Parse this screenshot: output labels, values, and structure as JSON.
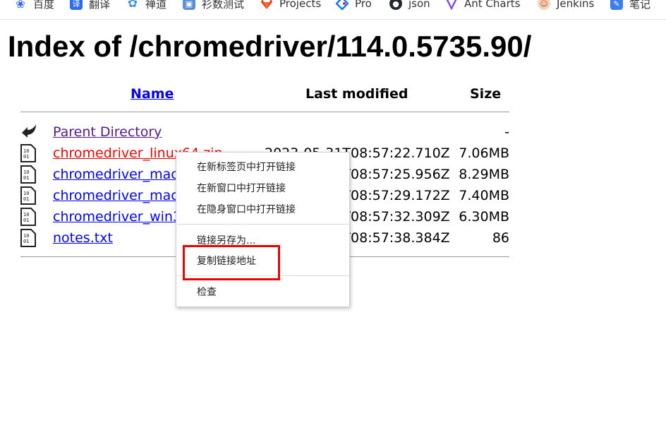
{
  "bookmarks": [
    {
      "label": "百度",
      "icon": "baidu-paw-icon",
      "color": "#3062f0"
    },
    {
      "label": "翻译",
      "icon": "translate-icon",
      "color": "#2a6bf2"
    },
    {
      "label": "禅道",
      "icon": "zentao-icon",
      "color": "#3d8fe8"
    },
    {
      "label": "衫数测试",
      "icon": "cube-icon",
      "color": "#5b8fd8"
    },
    {
      "label": "Projects",
      "icon": "gitlab-icon",
      "color": "#e24329"
    },
    {
      "label": "Pro",
      "icon": "diamond-icon",
      "color": "#1677ff"
    },
    {
      "label": "json",
      "icon": "github-icon",
      "color": "#24292e"
    },
    {
      "label": "Ant Charts",
      "icon": "ant-v-icon",
      "color": "#8a4bd8"
    },
    {
      "label": "Jenkins",
      "icon": "jenkins-icon",
      "color": "#d24939"
    },
    {
      "label": "笔记",
      "icon": "note-icon",
      "color": "#3b7cf0"
    }
  ],
  "page": {
    "title": "Index of /chromedriver/114.0.5735.90/",
    "columns": {
      "name": "Name",
      "last_modified": "Last modified",
      "size": "Size"
    }
  },
  "files": [
    {
      "name": "Parent Directory",
      "date": "",
      "size": "-",
      "icon": "back-arrow-icon",
      "link_color": "#551a8b"
    },
    {
      "name": "chromedriver_linux64.zip",
      "date": "2023-05-31T08:57:22.710Z",
      "size": "7.06MB",
      "icon": "binary-file-icon",
      "link_color": "#ee0000"
    },
    {
      "name": "chromedriver_mac64.zip",
      "date": "2023-05-31T08:57:25.956Z",
      "size": "8.29MB",
      "icon": "binary-file-icon",
      "link_color": "#0000ee"
    },
    {
      "name": "chromedriver_mac_arm64.zip",
      "date": "2023-05-31T08:57:29.172Z",
      "size": "7.40MB",
      "icon": "binary-file-icon",
      "link_color": "#0000ee"
    },
    {
      "name": "chromedriver_win32.zip",
      "date": "2023-05-31T08:57:32.309Z",
      "size": "6.30MB",
      "icon": "binary-file-icon",
      "link_color": "#0000ee"
    },
    {
      "name": "notes.txt",
      "date": "2023-05-31T08:57:38.384Z",
      "size": "86",
      "icon": "binary-file-icon",
      "link_color": "#0000ee"
    }
  ],
  "context_menu": {
    "items": [
      "在新标签页中打开链接",
      "在新窗口中打开链接",
      "在隐身窗口中打开链接",
      "链接另存为...",
      "复制链接地址",
      "检查"
    ],
    "highlighted_item": "复制链接地址",
    "highlight_color": "#ee0000"
  }
}
